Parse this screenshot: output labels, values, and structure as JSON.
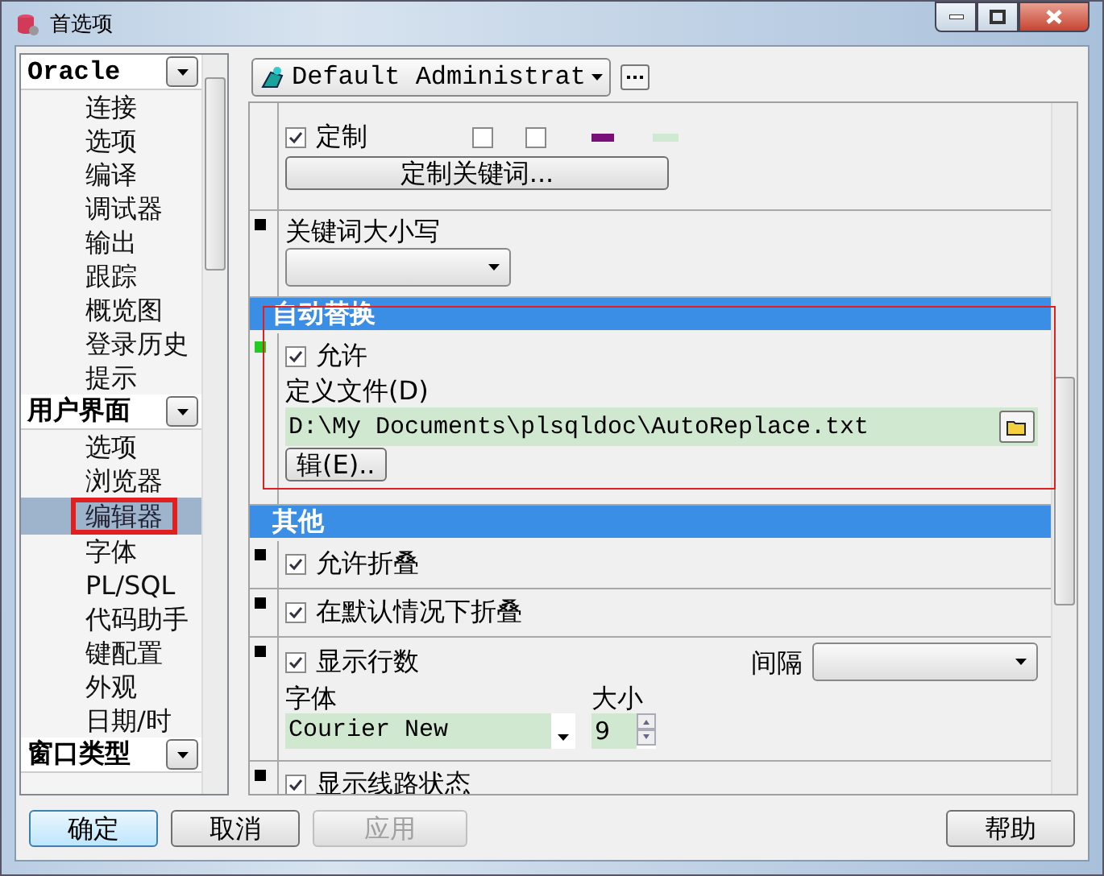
{
  "window": {
    "title": "首选项"
  },
  "sidebar": {
    "groups": [
      {
        "label": "Oracle",
        "items": [
          {
            "label": "连接",
            "selected": false
          },
          {
            "label": "选项",
            "selected": false
          },
          {
            "label": "编译",
            "selected": false
          },
          {
            "label": "调试器",
            "selected": false
          },
          {
            "label": "输出",
            "selected": false
          },
          {
            "label": "跟踪",
            "selected": false
          },
          {
            "label": "概览图",
            "selected": false
          },
          {
            "label": "登录历史",
            "selected": false
          },
          {
            "label": "提示",
            "selected": false
          }
        ]
      },
      {
        "label": "用户界面",
        "items": [
          {
            "label": "选项",
            "selected": false
          },
          {
            "label": "浏览器",
            "selected": false
          },
          {
            "label": "编辑器",
            "selected": true
          },
          {
            "label": "字体",
            "selected": false
          },
          {
            "label": "PL/SQL",
            "selected": false
          },
          {
            "label": "代码助手",
            "selected": false
          },
          {
            "label": "键配置",
            "selected": false
          },
          {
            "label": "外观",
            "selected": false
          },
          {
            "label": "日期/时",
            "selected": false
          }
        ]
      },
      {
        "label": "窗口类型"
      }
    ]
  },
  "profile": {
    "value": "Default Administrat"
  },
  "blocks": [
    {
      "kind": "keywords",
      "check": {
        "label": "定制",
        "checked": true
      },
      "options": [
        {
          "checked": false
        },
        {
          "checked": false
        }
      ],
      "swatches": [
        {
          "color": "#7a0f7a"
        },
        {
          "color": "#cfe9d2"
        }
      ],
      "button": "定制关键词..."
    },
    {
      "kind": "case",
      "color": "#000000",
      "label": "关键词大小写"
    },
    {
      "kind": "header",
      "label": "自动替换"
    },
    {
      "kind": "file",
      "color": "#22cc22",
      "check": {
        "label": "允许",
        "checked": true
      },
      "file_label": "定义文件(D)",
      "file_value": "D:\\My Documents\\plsqldoc\\AutoReplace.txt",
      "edit_button": "辑(E).."
    },
    {
      "kind": "header",
      "label": "其他"
    },
    {
      "kind": "check",
      "color": "#000000",
      "check": {
        "label": "允许折叠",
        "checked": true
      }
    },
    {
      "kind": "check",
      "color": "#000000",
      "check": {
        "label": "在默认情况下折叠",
        "checked": true
      }
    },
    {
      "kind": "line_numbers",
      "color": "#000000",
      "check": {
        "label": "显示行数",
        "checked": true
      },
      "interval_label": "间隔",
      "font_label": "字体",
      "font_value": "Courier New",
      "size_label": "大小",
      "size_value": "9"
    },
    {
      "kind": "check",
      "color": "#000000",
      "check": {
        "label": "显示线路状态",
        "checked": true
      }
    }
  ],
  "footer": {
    "buttons": [
      {
        "label": "确定",
        "default": true,
        "disabled": false
      },
      {
        "label": "取消",
        "default": false,
        "disabled": false
      },
      {
        "label": "应用",
        "default": false,
        "disabled": true
      }
    ],
    "help": "帮助"
  }
}
